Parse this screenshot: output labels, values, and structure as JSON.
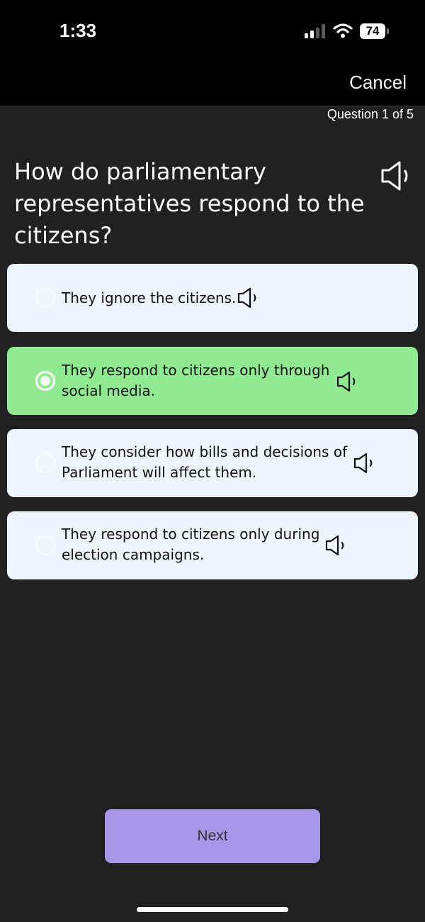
{
  "status_bar": {
    "time": "1:33",
    "battery_level": "74",
    "icons": [
      "cellular-signal-icon",
      "wifi-icon",
      "battery-icon"
    ]
  },
  "header": {
    "cancel_label": "Cancel"
  },
  "quiz": {
    "progress": "Question 1 of 5",
    "question": "How do parliamentary representatives respond to the citizens?",
    "options": [
      {
        "label": "They ignore the citizens.",
        "selected": false
      },
      {
        "label": "They respond to citizens only through social media.",
        "selected": true
      },
      {
        "label": "They consider how bills and decisions of Parliament will affect them.",
        "selected": false
      },
      {
        "label": "They respond to citizens only during election campaigns.",
        "selected": false
      }
    ]
  },
  "footer": {
    "next_label": "Next"
  },
  "colors": {
    "background": "#212121",
    "status_bar": "#000000",
    "option_default": "#eef5fc",
    "option_selected": "#90ea90",
    "next_button": "#a897e6"
  }
}
